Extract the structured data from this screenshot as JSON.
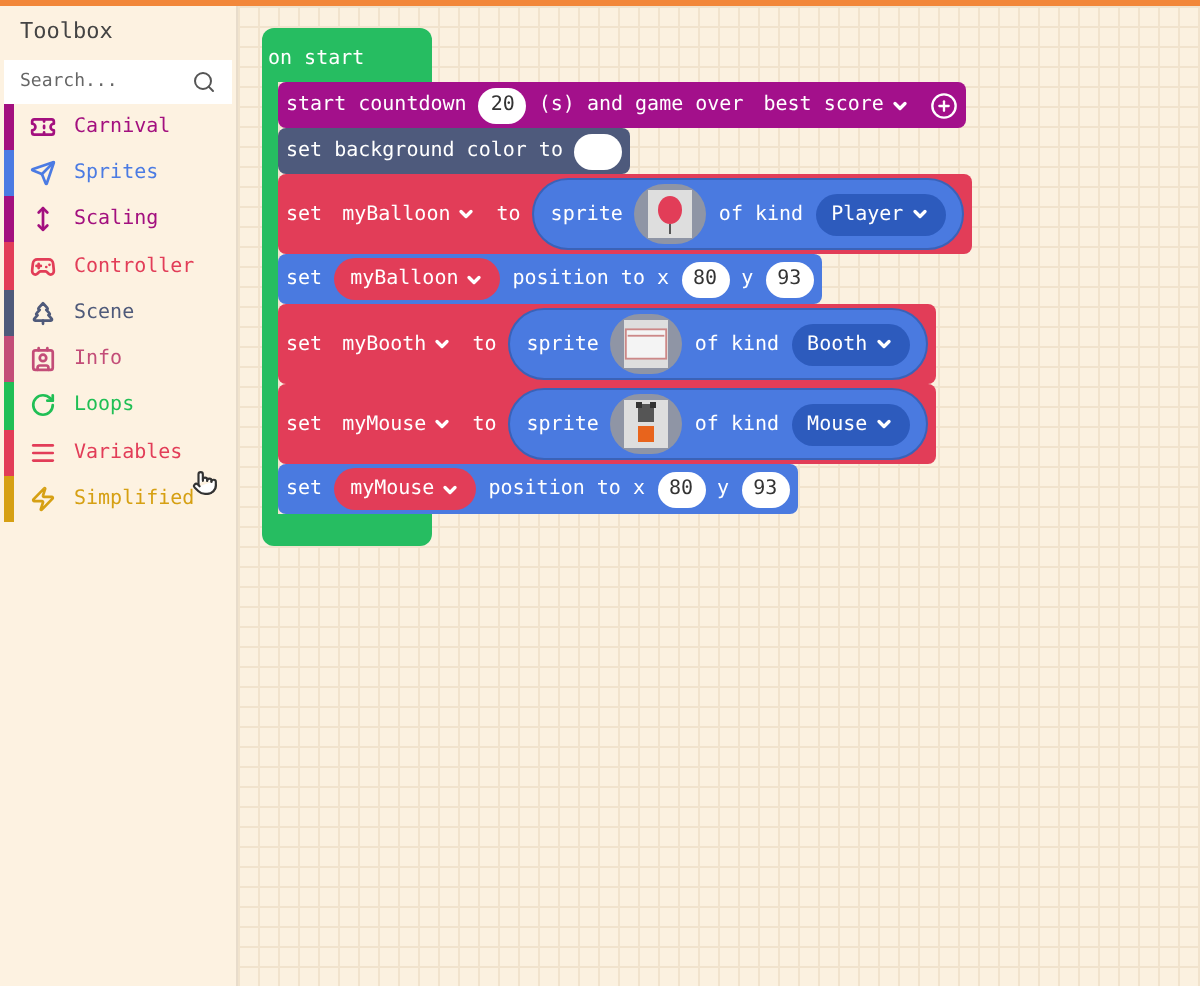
{
  "toolbox": {
    "title": "Toolbox",
    "search": {
      "placeholder": "Search..."
    },
    "categories": [
      {
        "label": "Carnival",
        "color": "#a3107f"
      },
      {
        "label": "Sprites",
        "color": "#4b7be3"
      },
      {
        "label": "Scaling",
        "color": "#a3107f"
      },
      {
        "label": "Controller",
        "color": "#e23d58"
      },
      {
        "label": "Scene",
        "color": "#4f5a7a"
      },
      {
        "label": "Info",
        "color": "#c34d78"
      },
      {
        "label": "Loops",
        "color": "#20bf55"
      },
      {
        "label": "Variables",
        "color": "#e23d58"
      },
      {
        "label": "Simplified",
        "color": "#d6a013"
      }
    ]
  },
  "workspace": {
    "hat": {
      "label": "on start"
    },
    "blocks": [
      {
        "color": "#a3108b",
        "parts": [
          {
            "kind": "text",
            "text": "start countdown"
          },
          {
            "kind": "number",
            "text": "20"
          },
          {
            "kind": "text",
            "text": "(s) and game over"
          },
          {
            "kind": "dropdown",
            "text": "best score"
          },
          {
            "kind": "plus"
          }
        ]
      },
      {
        "color": "#4e5a7c",
        "parts": [
          {
            "kind": "text",
            "text": "set background color to"
          },
          {
            "kind": "swatch"
          }
        ]
      },
      {
        "color": "#e23d58",
        "parts": [
          {
            "kind": "text",
            "text": "set"
          },
          {
            "kind": "dropdown",
            "text": "myBalloon"
          },
          {
            "kind": "text",
            "text": "to"
          },
          {
            "kind": "sprite",
            "label": "sprite",
            "of": "of kind",
            "type": "Player"
          }
        ]
      },
      {
        "color": "#4a7ae0",
        "parts": [
          {
            "kind": "text",
            "text": "set"
          },
          {
            "kind": "variable",
            "text": "myBalloon"
          },
          {
            "kind": "text",
            "text": "position to x"
          },
          {
            "kind": "number",
            "text": "80"
          },
          {
            "kind": "text",
            "text": "y"
          },
          {
            "kind": "number",
            "text": "93"
          }
        ]
      },
      {
        "color": "#e23d58",
        "parts": [
          {
            "kind": "text",
            "text": "set"
          },
          {
            "kind": "dropdown",
            "text": "myBooth"
          },
          {
            "kind": "text",
            "text": "to"
          },
          {
            "kind": "sprite",
            "label": "sprite",
            "of": "of kind",
            "type": "Booth"
          }
        ]
      },
      {
        "color": "#e23d58",
        "parts": [
          {
            "kind": "text",
            "text": "set"
          },
          {
            "kind": "dropdown",
            "text": "myMouse"
          },
          {
            "kind": "text",
            "text": "to"
          },
          {
            "kind": "sprite",
            "label": "sprite",
            "of": "of kind",
            "type": "Mouse"
          }
        ]
      },
      {
        "color": "#4a7ae0",
        "parts": [
          {
            "kind": "text",
            "text": "set"
          },
          {
            "kind": "variable",
            "text": "myMouse"
          },
          {
            "kind": "text",
            "text": "position to x"
          },
          {
            "kind": "number",
            "text": "80"
          },
          {
            "kind": "text",
            "text": "y"
          },
          {
            "kind": "number",
            "text": "93"
          }
        ]
      }
    ]
  }
}
